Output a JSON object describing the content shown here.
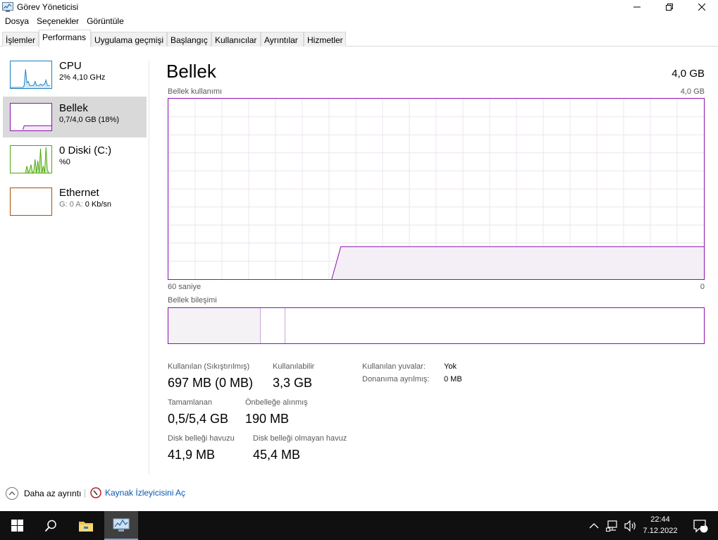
{
  "window": {
    "title": "Görev Yöneticisi",
    "minimize_icon": "minimize-icon",
    "restore_icon": "restore-icon",
    "close_icon": "close-icon"
  },
  "menu": [
    "Dosya",
    "Seçenekler",
    "Görüntüle"
  ],
  "tabs": [
    "İşlemler",
    "Performans",
    "Uygulama geçmişi",
    "Başlangıç",
    "Kullanıcılar",
    "Ayrıntılar",
    "Hizmetler"
  ],
  "active_tab": "Performans",
  "sidebar": {
    "items": [
      {
        "name": "CPU",
        "sub": "2% 4,10 GHz",
        "color": "#1a7fc1"
      },
      {
        "name": "Bellek",
        "sub": "0,7/4,0 GB (18%)",
        "color": "#8b12ae"
      },
      {
        "name": "0 Diski (C:)",
        "sub": "%0",
        "color": "#4da60c"
      },
      {
        "name": "Ethernet",
        "sub_prefix": "G:",
        "sub_mid": "0 A:",
        "sub_value": "0 Kb/sn",
        "color": "#a74f01"
      }
    ]
  },
  "main": {
    "title": "Bellek",
    "total": "4,0 GB",
    "usage_label": "Bellek kullanımı",
    "usage_max": "4,0 GB",
    "time_left": "60 saniye",
    "time_right": "0",
    "composition_label": "Bellek bileşimi",
    "accent_color": "#8b12ae",
    "usage_fraction": 0.18
  },
  "stats": {
    "used_label": "Kullanılan (Sıkıştırılmış)",
    "used_value": "697 MB (0 MB)",
    "available_label": "Kullanılabilir",
    "available_value": "3,3 GB",
    "committed_label": "Tamamlanan",
    "committed_value": "0,5/5,4 GB",
    "cached_label": "Önbelleğe alınmış",
    "cached_value": "190 MB",
    "paged_label": "Disk belleği havuzu",
    "paged_value": "41,9 MB",
    "nonpaged_label": "Disk belleği olmayan havuz",
    "nonpaged_value": "45,4 MB",
    "slots_label": "Kullanılan yuvalar:",
    "slots_value": "Yok",
    "reserved_label": "Donanıma ayrılmış:",
    "reserved_value": "0 MB"
  },
  "footer": {
    "fewer_details": "Daha az ayrıntı",
    "resource_monitor": "Kaynak İzleyicisini Aç"
  },
  "taskbar": {
    "time": "22:44",
    "date": "7.12.2022",
    "notification_count": "2"
  }
}
